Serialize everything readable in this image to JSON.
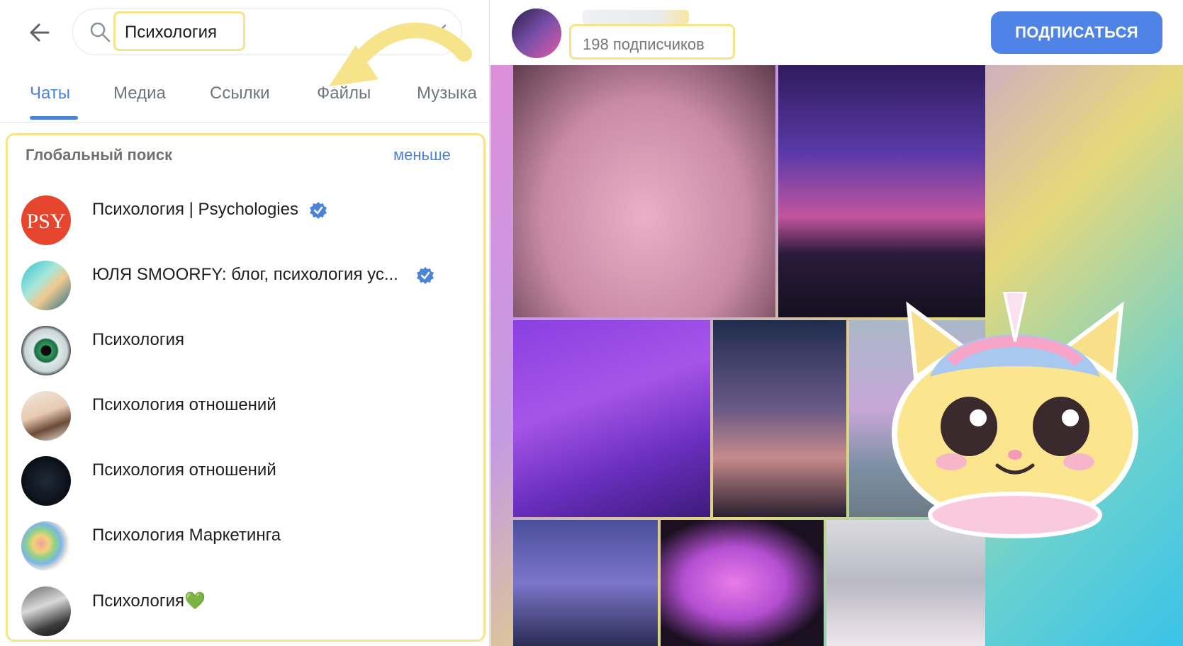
{
  "search": {
    "query": "Психология"
  },
  "tabs": [
    {
      "label": "Чаты",
      "active": true
    },
    {
      "label": "Медиа",
      "active": false
    },
    {
      "label": "Ссылки",
      "active": false
    },
    {
      "label": "Файлы",
      "active": false
    },
    {
      "label": "Музыка",
      "active": false
    }
  ],
  "global_search": {
    "title": "Глобальный поиск",
    "toggle_label": "меньше",
    "results": [
      {
        "name": "Психология | Psychologies",
        "verified": true
      },
      {
        "name": "ЮЛЯ SMOORFY: блог, психология ус...",
        "verified": true
      },
      {
        "name": "Психология",
        "verified": false
      },
      {
        "name": "Психология отношений",
        "verified": false
      },
      {
        "name": "Психология отношений",
        "verified": false
      },
      {
        "name": "Психология Маркетинга",
        "verified": false
      },
      {
        "name": "Психология💚",
        "verified": false
      }
    ]
  },
  "channel": {
    "subscribers": "198 подписчиков",
    "subscribe_label": "ПОДПИСАТЬСЯ"
  },
  "colors": {
    "accent": "#4a83d8",
    "highlight": "#f6e38a",
    "button": "#4f83e6"
  }
}
